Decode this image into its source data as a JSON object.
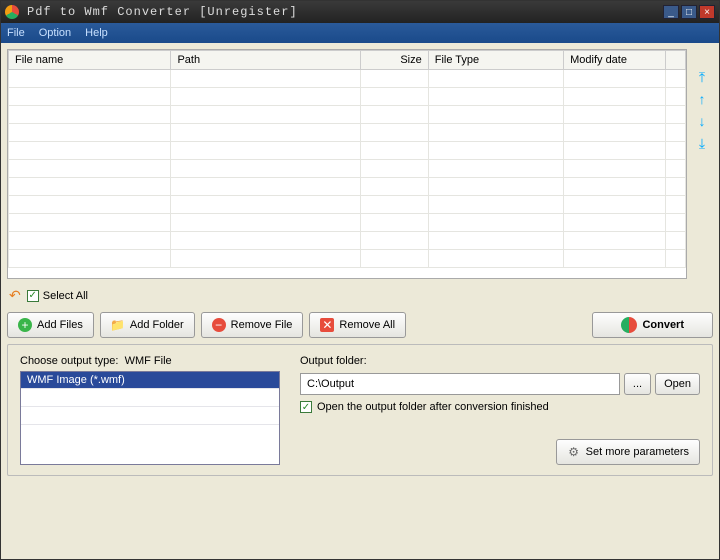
{
  "window": {
    "title": "Pdf to Wmf Converter [Unregister]"
  },
  "menu": {
    "file": "File",
    "option": "Option",
    "help": "Help"
  },
  "table": {
    "cols": {
      "filename": "File name",
      "path": "Path",
      "size": "Size",
      "filetype": "File Type",
      "modify": "Modify date"
    }
  },
  "side": {
    "top": "⤒",
    "up": "↑",
    "down": "↓",
    "bottom": "⤓"
  },
  "selectall": {
    "label": "Select All",
    "checked": "✓"
  },
  "toolbar": {
    "add_files": "Add Files",
    "add_folder": "Add Folder",
    "remove_file": "Remove File",
    "remove_all": "Remove All",
    "convert": "Convert"
  },
  "output_type": {
    "label_prefix": "Choose output type:",
    "current": "WMF File",
    "list_item": "WMF Image (*.wmf)"
  },
  "output_folder": {
    "label": "Output folder:",
    "path": "C:\\Output",
    "browse": "...",
    "open": "Open",
    "open_after": "Open the output folder after conversion finished",
    "open_after_checked": "✓"
  },
  "more_params": {
    "label": "Set more parameters"
  }
}
